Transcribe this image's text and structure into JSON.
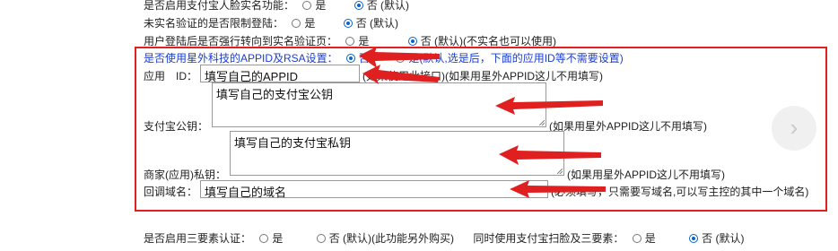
{
  "rows_top": [
    {
      "label": "是否启用支付宝人脸实名功能：",
      "opt1": "是",
      "opt2": "否 (默认)"
    },
    {
      "label": "未实名验证的是否限制登陆：",
      "opt1": "是",
      "opt2": "否 (默认)"
    },
    {
      "label": "用户登陆后是否强行转向到实名验证页：",
      "opt1": "是",
      "opt2": "否 (默认)(不实名也可以使用)"
    }
  ],
  "box": {
    "question": "是否使用星外科技的APPID及RSA设置：",
    "no": "否",
    "yes_note": "是(默认,选是后，下面的应用ID等不需要设置)",
    "appid_label": "应用　ID：",
    "appid_value": "填写自己的APPID",
    "appid_note": "(如果使用此接口)(如果用星外APPID这儿不用填写)",
    "pubkey_label": "支付宝公钥：",
    "pubkey_value": "填写自己的支付宝公钥",
    "pubkey_note": "(如果用星外APPID这儿不用填写)",
    "privkey_label": "商家(应用)私钥：",
    "privkey_value": "填写自己的支付宝私钥",
    "privkey_note": "(如果用星外APPID这儿不用填写)",
    "callback_label": "回调域名：",
    "callback_value": "填写自己的域名",
    "callback_note": "(必须填写，只需要写域名,可以写主控的其中一个域名)"
  },
  "bottom": {
    "label": "是否启用三要素认证：",
    "opt1": "是",
    "opt2": "否 (默认)(此功能另外购买)",
    "label2": "同时使用支付宝扫脸及三要素：",
    "opt3": "是",
    "opt4": "否 (默认)"
  },
  "colors": {
    "red_box": "#e02020",
    "arrow": "#e02020",
    "question_text": "#1a3fd0"
  },
  "icons": [
    "chevron-right-icon"
  ]
}
